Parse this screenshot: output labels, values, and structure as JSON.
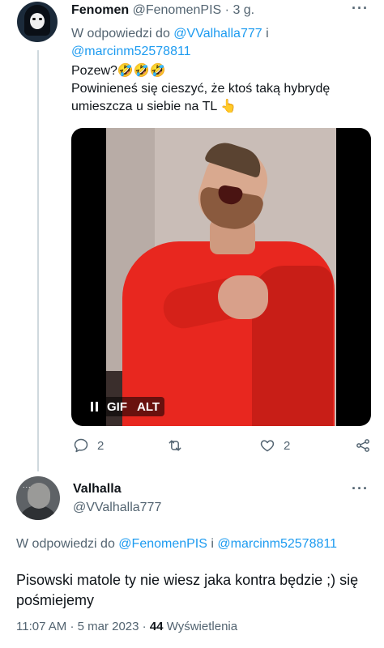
{
  "tweet1": {
    "display_name": "Fenomen",
    "handle": "@FenomenPIS",
    "separator": "·",
    "time": "3 g.",
    "reply_prefix": "W odpowiedzi do",
    "reply_user1": "@VValhalla777",
    "reply_and": "i",
    "reply_user2": "@marcinm52578811",
    "text_line1": "Pozew?🤣🤣🤣",
    "text_line2": "Powinieneś się cieszyć, że ktoś taką hybrydę umieszcza u siebie na TL 👆",
    "media": {
      "gif_label": "GIF",
      "alt_label": "ALT",
      "pause_icon": "pause-icon"
    },
    "actions": {
      "replies": "2",
      "retweets": "",
      "likes": "2"
    },
    "more_icon": "···"
  },
  "tweet2": {
    "display_name": "Valhalla",
    "handle": "@VValhalla777",
    "avatar_dots": "...",
    "reply_prefix": "W odpowiedzi do",
    "reply_user1": "@FenomenPIS",
    "reply_and": "i",
    "reply_user2": "@marcinm52578811",
    "text": "Pisowski matole ty nie wiesz jaka kontra będzie ;) się pośmiejemy",
    "time": "11:07 AM",
    "separator": "·",
    "date": "5 mar 2023",
    "separator2": "·",
    "views_count": "44",
    "views_label": "Wyświetlenia",
    "more_icon": "···"
  },
  "colors": {
    "link": "#1d9bf0",
    "muted": "#536471",
    "text": "#0f1419",
    "thread_line": "#cfd9de"
  }
}
